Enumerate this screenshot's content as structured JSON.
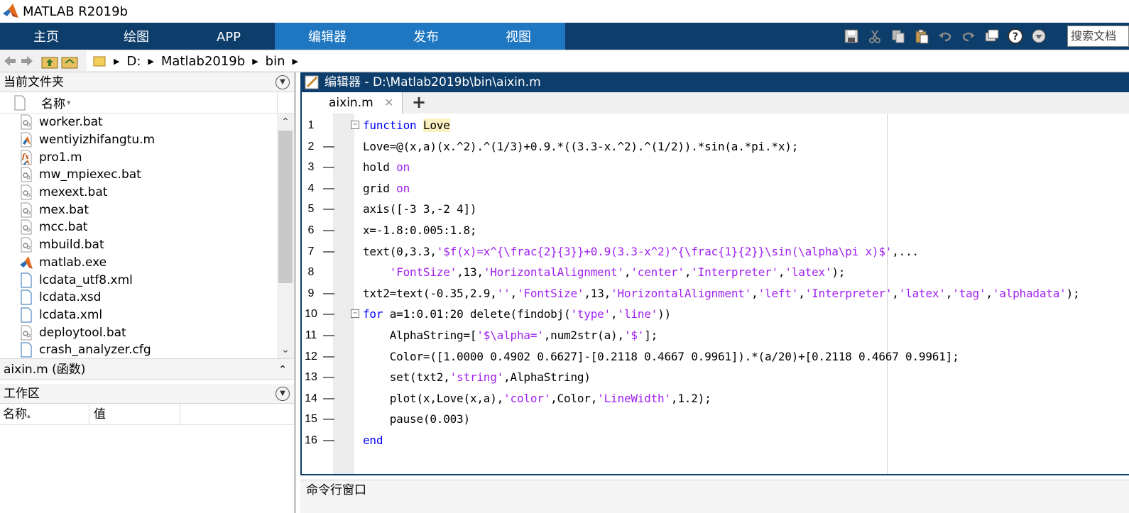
{
  "window": {
    "title": "MATLAB R2019b"
  },
  "ribbon": {
    "tabs": [
      "主页",
      "绘图",
      "APP",
      "编辑器",
      "发布",
      "视图"
    ],
    "selected_tab": "编辑器",
    "search_placeholder": "搜索文档"
  },
  "quickaccess": {
    "icons": [
      "save-icon",
      "cut-icon",
      "copy-icon",
      "paste-icon",
      "undo-icon",
      "redo-icon",
      "switch-windows-icon",
      "help-icon",
      "dropdown-icon"
    ]
  },
  "address": {
    "segments": [
      "D:",
      "Matlab2019b",
      "bin"
    ]
  },
  "current_folder": {
    "title": "当前文件夹",
    "name_column": "名称",
    "sort_indicator": "▾",
    "files": [
      {
        "name": "worker.bat",
        "icon": "batch-file-icon"
      },
      {
        "name": "wentiyizhifangtu.m",
        "icon": "script-file-icon"
      },
      {
        "name": "pro1.m",
        "icon": "function-file-icon"
      },
      {
        "name": "mw_mpiexec.bat",
        "icon": "batch-file-icon"
      },
      {
        "name": "mexext.bat",
        "icon": "batch-file-icon"
      },
      {
        "name": "mex.bat",
        "icon": "batch-file-icon"
      },
      {
        "name": "mcc.bat",
        "icon": "batch-file-icon"
      },
      {
        "name": "mbuild.bat",
        "icon": "batch-file-icon"
      },
      {
        "name": "matlab.exe",
        "icon": "matlab-logo-icon"
      },
      {
        "name": "lcdata_utf8.xml",
        "icon": "file-icon"
      },
      {
        "name": "lcdata.xsd",
        "icon": "file-icon"
      },
      {
        "name": "lcdata.xml",
        "icon": "file-icon"
      },
      {
        "name": "deploytool.bat",
        "icon": "batch-file-icon"
      },
      {
        "name": "crash_analyzer.cfg",
        "icon": "file-icon"
      },
      {
        "name": "aixin.m",
        "icon": "function-file-icon",
        "selected": true
      }
    ]
  },
  "details": {
    "label": "aixin.m  (函数)"
  },
  "workspace": {
    "title": "工作区",
    "columns": [
      "名称",
      "值"
    ],
    "sort_indicator": "▴"
  },
  "editor": {
    "header": "编辑器 - D:\\Matlab2019b\\bin\\aixin.m",
    "tab_label": "aixin.m",
    "add_tab": "+",
    "lines": [
      {
        "n": "1",
        "dash": "",
        "fold": "−",
        "segs": [
          [
            "kw",
            "function "
          ],
          [
            "hl",
            "Love"
          ]
        ]
      },
      {
        "n": "2",
        "dash": "—",
        "segs": [
          [
            "p",
            "Love=@(x,a)(x.^2).^(1/3)+0.9.*((3.3-x.^2).^(1/2)).*sin(a.*pi.*x);"
          ]
        ]
      },
      {
        "n": "3",
        "dash": "—",
        "segs": [
          [
            "p",
            "hold "
          ],
          [
            "str",
            "on"
          ]
        ]
      },
      {
        "n": "4",
        "dash": "—",
        "segs": [
          [
            "p",
            "grid "
          ],
          [
            "str",
            "on"
          ]
        ]
      },
      {
        "n": "5",
        "dash": "—",
        "segs": [
          [
            "p",
            "axis([-3 3,-2 4])"
          ]
        ]
      },
      {
        "n": "6",
        "dash": "—",
        "segs": [
          [
            "p",
            "x=-1.8:0.005:1.8;"
          ]
        ]
      },
      {
        "n": "7",
        "dash": "—",
        "segs": [
          [
            "p",
            "text(0,3.3,"
          ],
          [
            "str",
            "'$f(x)=x^{\\frac{2}{3}}+0.9(3.3-x^2)^{\\frac{1}{2}}\\sin(\\alpha\\pi x)$'"
          ],
          [
            "p",
            ",..."
          ]
        ]
      },
      {
        "n": "8",
        "dash": "",
        "segs": [
          [
            "p",
            "    "
          ],
          [
            "str",
            "'FontSize'"
          ],
          [
            "p",
            ",13,"
          ],
          [
            "str",
            "'HorizontalAlignment'"
          ],
          [
            "p",
            ","
          ],
          [
            "str",
            "'center'"
          ],
          [
            "p",
            ","
          ],
          [
            "str",
            "'Interpreter'"
          ],
          [
            "p",
            ","
          ],
          [
            "str",
            "'latex'"
          ],
          [
            "p",
            ");"
          ]
        ]
      },
      {
        "n": "9",
        "dash": "—",
        "segs": [
          [
            "p",
            "txt2=text(-0.35,2.9,"
          ],
          [
            "str",
            "''"
          ],
          [
            "p",
            ","
          ],
          [
            "str",
            "'FontSize'"
          ],
          [
            "p",
            ",13,"
          ],
          [
            "str",
            "'HorizontalAlignment'"
          ],
          [
            "p",
            ","
          ],
          [
            "str",
            "'left'"
          ],
          [
            "p",
            ","
          ],
          [
            "str",
            "'Interpreter'"
          ],
          [
            "p",
            ","
          ],
          [
            "str",
            "'latex'"
          ],
          [
            "p",
            ","
          ],
          [
            "str",
            "'tag'"
          ],
          [
            "p",
            ","
          ],
          [
            "str",
            "'alphadata'"
          ],
          [
            "p",
            ");"
          ]
        ]
      },
      {
        "n": "10",
        "dash": "—",
        "fold": "−",
        "segs": [
          [
            "kw",
            "for "
          ],
          [
            "p",
            "a=1:0.01:20 delete(findobj("
          ],
          [
            "str",
            "'type'"
          ],
          [
            "p",
            ","
          ],
          [
            "str",
            "'line'"
          ],
          [
            "p",
            "))"
          ]
        ]
      },
      {
        "n": "11",
        "dash": "—",
        "segs": [
          [
            "p",
            "    AlphaString=["
          ],
          [
            "str",
            "'$\\alpha='"
          ],
          [
            "p",
            ",num2str(a),"
          ],
          [
            "str",
            "'$'"
          ],
          [
            "p",
            "];"
          ]
        ]
      },
      {
        "n": "12",
        "dash": "—",
        "segs": [
          [
            "p",
            "    Color=([1.0000 0.4902 0.6627]-[0.2118 0.4667 0.9961]).*(a/20)+[0.2118 0.4667 0.9961];"
          ]
        ]
      },
      {
        "n": "13",
        "dash": "—",
        "segs": [
          [
            "p",
            "    set(txt2,"
          ],
          [
            "str",
            "'string'"
          ],
          [
            "p",
            ",AlphaString)"
          ]
        ]
      },
      {
        "n": "14",
        "dash": "—",
        "segs": [
          [
            "p",
            "    plot(x,Love(x,a),"
          ],
          [
            "str",
            "'color'"
          ],
          [
            "p",
            ",Color,"
          ],
          [
            "str",
            "'LineWidth'"
          ],
          [
            "p",
            ",1.2);"
          ]
        ]
      },
      {
        "n": "15",
        "dash": "—",
        "segs": [
          [
            "p",
            "    pause(0.003)"
          ]
        ]
      },
      {
        "n": "16",
        "dash": "—",
        "segs": [
          [
            "kw",
            "end"
          ]
        ]
      }
    ]
  },
  "command_window": {
    "title": "命令行窗口"
  },
  "colors": {
    "ribbon_bg": "#0d3d6b",
    "ribbon_selected": "#1f77c2",
    "keyword": "#0000ff",
    "string": "#a020f0"
  }
}
